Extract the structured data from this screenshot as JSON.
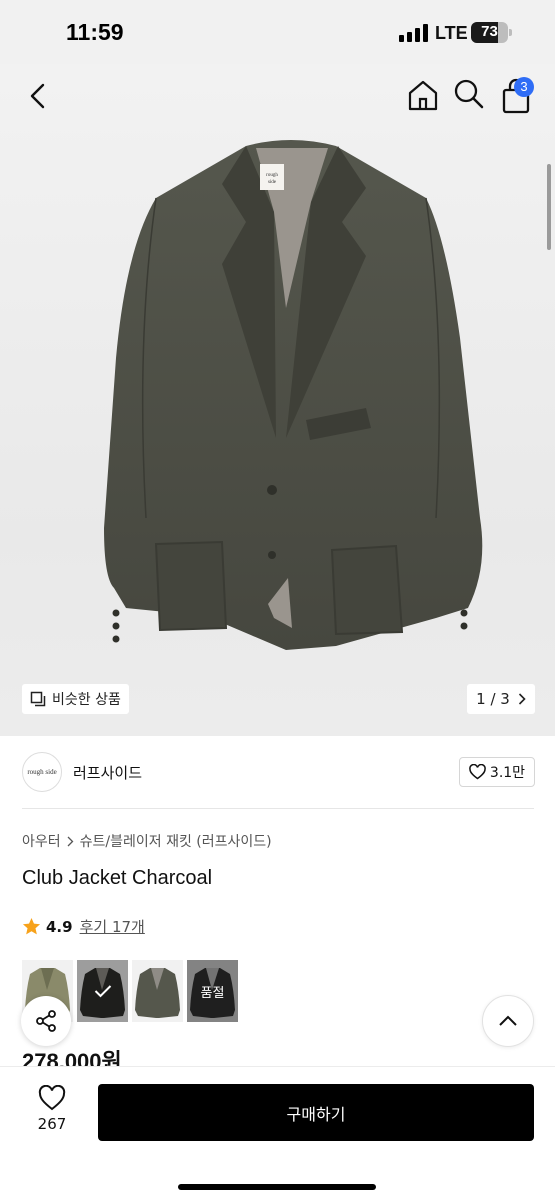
{
  "status_bar": {
    "time": "11:59",
    "network": "LTE",
    "battery": "73",
    "battery_level": 0.73
  },
  "header": {
    "cart_count": "3",
    "icons": [
      "back-icon",
      "home-icon",
      "search-icon",
      "bag-icon"
    ]
  },
  "gallery": {
    "similar_label": "비슷한 상품",
    "page_indicator": "1 / 3",
    "brand_tag": "rough side"
  },
  "brand": {
    "logo_text": "rough side",
    "name": "러프사이드",
    "likes": "3.1만"
  },
  "product": {
    "breadcrumb": [
      "아우터",
      "슈트/블레이저 재킷 (러프사이드)"
    ],
    "title": "Club Jacket Charcoal",
    "rating": "4.9",
    "reviews": "후기 17개",
    "price": "278,000원",
    "swatches": [
      {
        "color": "#8a8a6a",
        "state": "normal"
      },
      {
        "color": "#2e2e2b",
        "state": "selected"
      },
      {
        "color": "#55574c",
        "state": "normal"
      },
      {
        "color": "#151515",
        "state": "soldout",
        "label": "품절"
      }
    ]
  },
  "bottom_bar": {
    "wish_count": "267",
    "buy_label": "구매하기"
  },
  "colors": {
    "accent": "#2f6df6",
    "star": "#f7a21b",
    "jacket": "#4b4c43"
  }
}
